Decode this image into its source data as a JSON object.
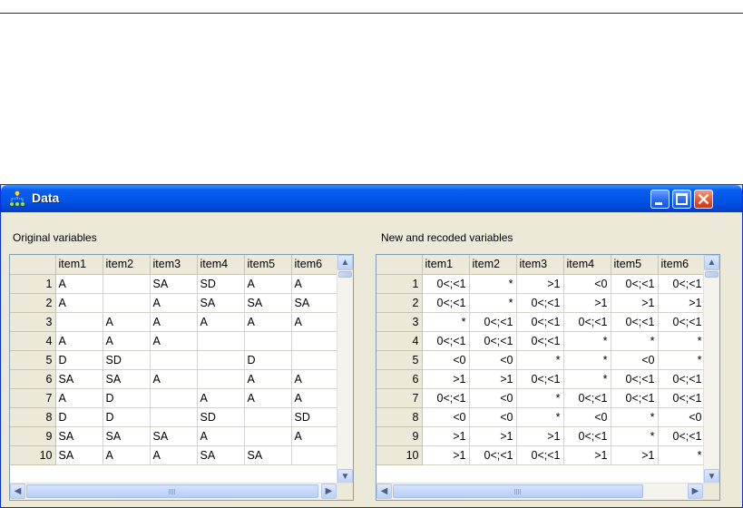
{
  "window": {
    "title": "Data",
    "icon": "data-network-icon",
    "accent": "#0055e6",
    "close_color": "#e2512b"
  },
  "left": {
    "label": "Original variables",
    "columns": [
      "item1",
      "item2",
      "item3",
      "item4",
      "item5",
      "item6"
    ],
    "rows": [
      {
        "n": "1",
        "v": [
          "A",
          "",
          "SA",
          "SD",
          "A",
          "A"
        ]
      },
      {
        "n": "2",
        "v": [
          "A",
          "",
          "A",
          "SA",
          "SA",
          "SA"
        ]
      },
      {
        "n": "3",
        "v": [
          "",
          "A",
          "A",
          "A",
          "A",
          "A"
        ]
      },
      {
        "n": "4",
        "v": [
          "A",
          "A",
          "A",
          "",
          "",
          ""
        ]
      },
      {
        "n": "5",
        "v": [
          "D",
          "SD",
          "",
          "",
          "D",
          ""
        ]
      },
      {
        "n": "6",
        "v": [
          "SA",
          "SA",
          "A",
          "",
          "A",
          "A"
        ]
      },
      {
        "n": "7",
        "v": [
          "A",
          "D",
          "",
          "A",
          "A",
          "A"
        ]
      },
      {
        "n": "8",
        "v": [
          "D",
          "D",
          "",
          "SD",
          "",
          "SD"
        ]
      },
      {
        "n": "9",
        "v": [
          "SA",
          "SA",
          "SA",
          "A",
          "",
          "A"
        ]
      },
      {
        "n": "10",
        "v": [
          "SA",
          "A",
          "A",
          "SA",
          "SA",
          ""
        ]
      }
    ]
  },
  "right": {
    "label": "New and recoded variables",
    "columns": [
      "item1",
      "item2",
      "item3",
      "item4",
      "item5",
      "item6"
    ],
    "rows": [
      {
        "n": "1",
        "v": [
          "0<;<1",
          "*",
          ">1",
          "<0",
          "0<;<1",
          "0<;<1"
        ]
      },
      {
        "n": "2",
        "v": [
          "0<;<1",
          "*",
          "0<;<1",
          ">1",
          ">1",
          ">1"
        ]
      },
      {
        "n": "3",
        "v": [
          "*",
          "0<;<1",
          "0<;<1",
          "0<;<1",
          "0<;<1",
          "0<;<1"
        ]
      },
      {
        "n": "4",
        "v": [
          "0<;<1",
          "0<;<1",
          "0<;<1",
          "*",
          "*",
          "*"
        ]
      },
      {
        "n": "5",
        "v": [
          "<0",
          "<0",
          "*",
          "*",
          "<0",
          "*"
        ]
      },
      {
        "n": "6",
        "v": [
          ">1",
          ">1",
          "0<;<1",
          "*",
          "0<;<1",
          "0<;<1"
        ]
      },
      {
        "n": "7",
        "v": [
          "0<;<1",
          "<0",
          "*",
          "0<;<1",
          "0<;<1",
          "0<;<1"
        ]
      },
      {
        "n": "8",
        "v": [
          "<0",
          "<0",
          "*",
          "<0",
          "*",
          "<0"
        ]
      },
      {
        "n": "9",
        "v": [
          ">1",
          ">1",
          ">1",
          "0<;<1",
          "*",
          "0<;<1"
        ]
      },
      {
        "n": "10",
        "v": [
          ">1",
          "0<;<1",
          "0<;<1",
          ">1",
          ">1",
          "*"
        ]
      }
    ]
  },
  "scroll": {
    "up": "▲",
    "down": "▼",
    "left": "◀",
    "right": "▶"
  }
}
